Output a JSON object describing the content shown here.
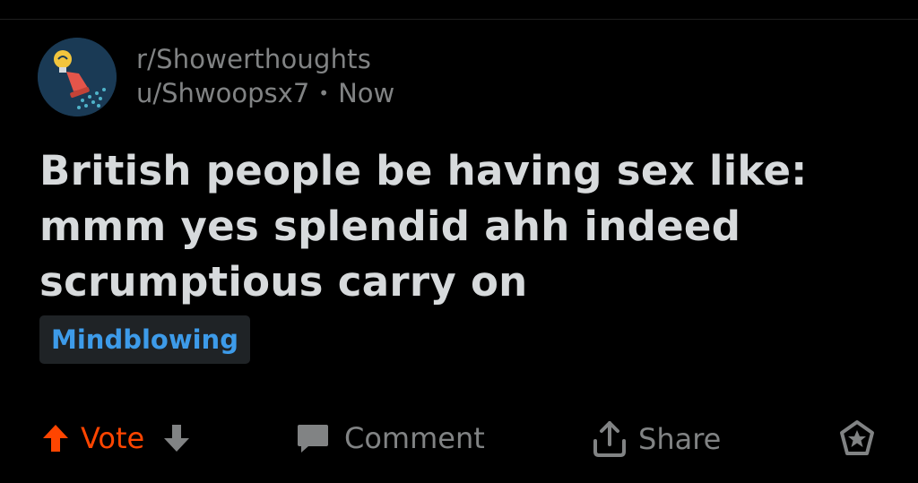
{
  "post": {
    "subreddit": "r/Showerthoughts",
    "username": "u/Shwoopsx7",
    "separator": "•",
    "timestamp": "Now",
    "title": "British people be having sex like: mmm yes splendid ahh indeed scrumptious carry on",
    "flair": "Mindblowing"
  },
  "actions": {
    "vote_label": "Vote",
    "comment_label": "Comment",
    "share_label": "Share"
  },
  "colors": {
    "background": "#000000",
    "title_text": "#d7dadc",
    "meta_text": "#818384",
    "upvote_accent": "#ff4500",
    "flair_text": "#3d9be9",
    "flair_bg": "#1f2326",
    "avatar_bg": "#1a3a55"
  },
  "icons": {
    "avatar": "shower-lightbulb-icon",
    "upvote": "arrow-up-icon",
    "downvote": "arrow-down-icon",
    "comment": "speech-bubble-icon",
    "share": "share-upload-icon",
    "award": "award-icon"
  }
}
